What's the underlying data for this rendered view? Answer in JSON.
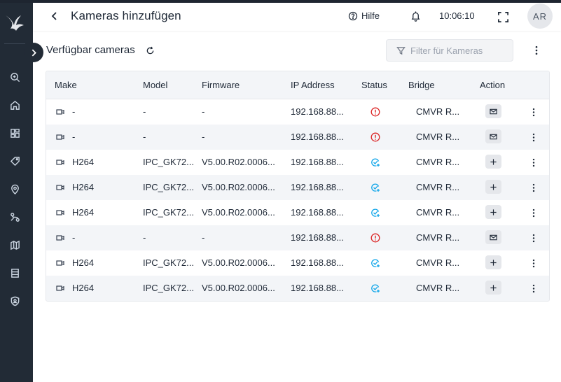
{
  "header": {
    "title": "Kameras hinzufügen",
    "help_label": "Hilfe",
    "time": "10:06:10",
    "avatar_initials": "AR"
  },
  "sidebar": {
    "items": [
      {
        "icon": "search-zoom-icon"
      },
      {
        "icon": "home-icon"
      },
      {
        "icon": "dashboard-icon"
      },
      {
        "icon": "tag-icon"
      },
      {
        "icon": "location-pin-icon"
      },
      {
        "icon": "route-icon"
      },
      {
        "icon": "map-icon"
      },
      {
        "icon": "server-icon"
      },
      {
        "icon": "shield-user-icon"
      }
    ]
  },
  "section": {
    "title": "Verfügbar cameras",
    "filter_placeholder": "Filter für Kameras"
  },
  "table": {
    "columns": [
      "Make",
      "Model",
      "Firmware",
      "IP Address",
      "Status",
      "Bridge",
      "Action"
    ],
    "rows": [
      {
        "make": "-",
        "model": "-",
        "firmware": "-",
        "ip": "192.168.88...",
        "status": "error",
        "bridge": "CMVR R...",
        "action": "mail"
      },
      {
        "make": "-",
        "model": "-",
        "firmware": "-",
        "ip": "192.168.88...",
        "status": "error",
        "bridge": "CMVR R...",
        "action": "mail"
      },
      {
        "make": "H264",
        "model": "IPC_GK72...",
        "firmware": "V5.00.R02.0006...",
        "ip": "192.168.88...",
        "status": "ok",
        "bridge": "CMVR R...",
        "action": "add"
      },
      {
        "make": "H264",
        "model": "IPC_GK72...",
        "firmware": "V5.00.R02.0006...",
        "ip": "192.168.88...",
        "status": "ok",
        "bridge": "CMVR R...",
        "action": "add"
      },
      {
        "make": "H264",
        "model": "IPC_GK72...",
        "firmware": "V5.00.R02.0006...",
        "ip": "192.168.88...",
        "status": "ok",
        "bridge": "CMVR R...",
        "action": "add"
      },
      {
        "make": "-",
        "model": "-",
        "firmware": "-",
        "ip": "192.168.88...",
        "status": "error",
        "bridge": "CMVR R...",
        "action": "mail"
      },
      {
        "make": "H264",
        "model": "IPC_GK72...",
        "firmware": "V5.00.R02.0006...",
        "ip": "192.168.88...",
        "status": "ok",
        "bridge": "CMVR R...",
        "action": "add"
      },
      {
        "make": "H264",
        "model": "IPC_GK72...",
        "firmware": "V5.00.R02.0006...",
        "ip": "192.168.88...",
        "status": "ok",
        "bridge": "CMVR R...",
        "action": "add"
      }
    ]
  },
  "colors": {
    "sidebar_bg": "#222b36",
    "error_red": "#dc2626",
    "ok_blue": "#0ea5e9",
    "row_stripe": "#f3f5f8"
  }
}
